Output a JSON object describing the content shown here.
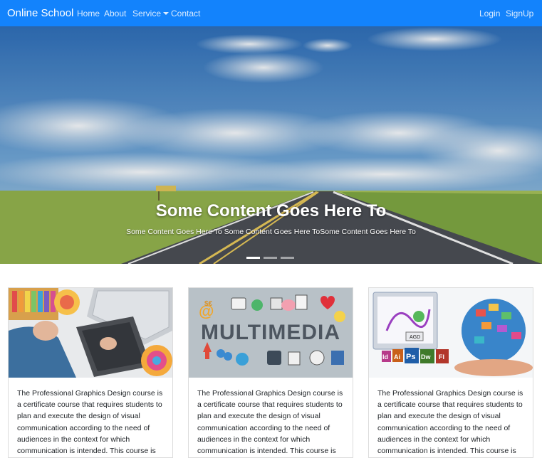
{
  "navbar": {
    "brand": "Online School",
    "links": [
      "Home",
      "About",
      "Service",
      "Contact"
    ],
    "auth": [
      "Login",
      "SignUp"
    ]
  },
  "hero": {
    "title": "Some Content Goes Here To",
    "subtitle": "Some Content Goes Here To Some Content Goes Here ToSome Content Goes Here To",
    "slides": 3,
    "active_slide": 1
  },
  "cards": [
    {
      "image": "graphic-design-desk-image",
      "text": "The Professional Graphics Design course is a certificate course that requires students to plan and execute the design of visual communication according to the need of audiences in the context for which communication is intended. This course is"
    },
    {
      "image": "multimedia-banner-image",
      "banner_text": "MULTIMEDIA",
      "text": "The Professional Graphics Design course is a certificate course that requires students to plan and execute the design of visual communication according to the need of audiences in the context for which communication is intended. This course is"
    },
    {
      "image": "adobe-apps-globe-image",
      "app_labels": [
        "AGD",
        "Id",
        "Ai",
        "Ps",
        "Dw",
        "Fl"
      ],
      "text": "The Professional Graphics Design course is a certificate course that requires students to plan and execute the design of visual communication according to the need of audiences in the context for which communication is intended. This course is"
    }
  ],
  "colors": {
    "navbar": "#1383fc",
    "sky": "#3f86c9",
    "grass": "#8fb24a",
    "road": "#4a4d52"
  }
}
